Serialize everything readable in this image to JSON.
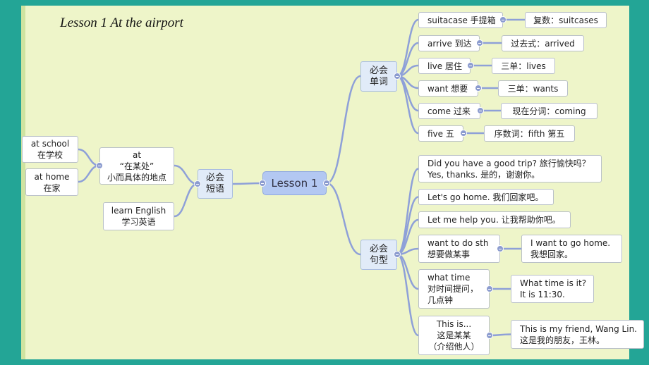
{
  "title": "Lesson 1 At the airport",
  "root": "Lesson 1",
  "categories": {
    "words": [
      "必会",
      "单词"
    ],
    "sentences": [
      "必会",
      "句型"
    ],
    "phrases": [
      "必会",
      "短语"
    ]
  },
  "words": [
    {
      "word": "suitacase 手提箱",
      "note": "复数：suitcases"
    },
    {
      "word": "arrive 到达",
      "note": "过去式：arrived"
    },
    {
      "word": "live 居住",
      "note": "三单：lives"
    },
    {
      "word": "want 想要",
      "note": "三单：wants"
    },
    {
      "word": "come 过来",
      "note": "现在分词：coming"
    },
    {
      "word": "five 五",
      "note": "序数词：fifth 第五"
    }
  ],
  "sentences": [
    {
      "lines": [
        "Did you have a good trip? 旅行愉快吗？",
        "Yes, thanks. 是的，谢谢你。"
      ]
    },
    {
      "lines": [
        "Let's go home. 我们回家吧。"
      ]
    },
    {
      "lines": [
        "Let me help you. 让我帮助你吧。"
      ]
    },
    {
      "lines": [
        "want to do sth",
        "想要做某事"
      ],
      "example": [
        "I want to go home.",
        "我想回家。"
      ]
    },
    {
      "lines": [
        "what time",
        "对时间提问，",
        "几点钟"
      ],
      "example": [
        "What time is it?",
        "It is 11:30."
      ]
    },
    {
      "lines": [
        "This is...",
        "这是某某",
        "（介绍他人）"
      ],
      "example": [
        "This is my friend, Wang Lin.",
        "这是我的朋友，王林。"
      ]
    }
  ],
  "phrases": {
    "at": [
      "at",
      "“在某处”",
      "小而具体的地点"
    ],
    "at_children": [
      [
        "at school",
        "在学校"
      ],
      [
        "at home",
        "在家"
      ]
    ],
    "learn": [
      "learn English",
      "学习英语"
    ]
  },
  "colors": {
    "background": "#23a596",
    "paper": "#eef5c9",
    "root": "#b3c8f2",
    "link": "#8ea0d8"
  }
}
